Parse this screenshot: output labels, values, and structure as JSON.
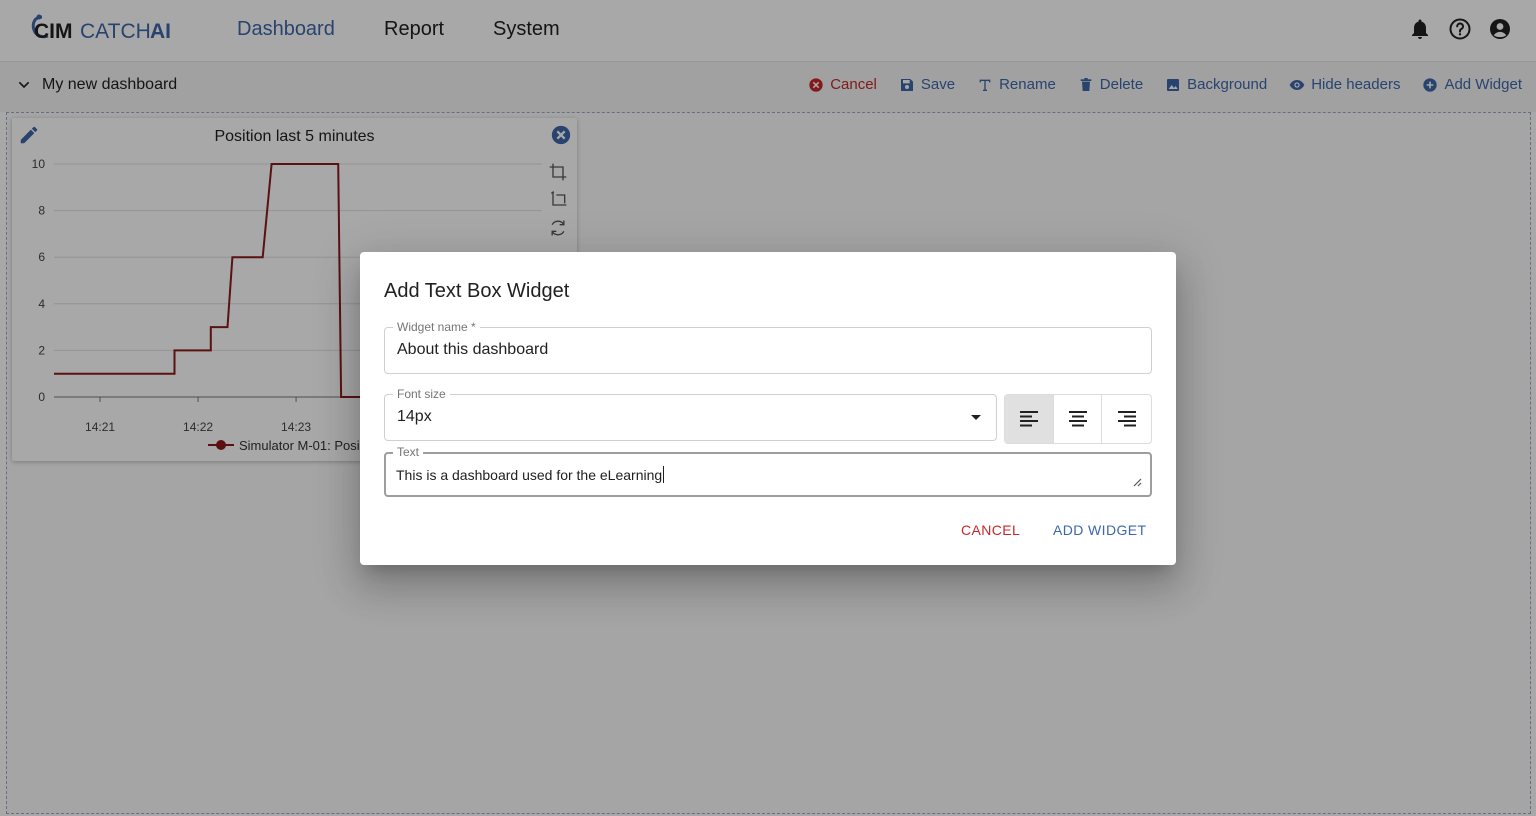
{
  "brand": {
    "cim": "CIM",
    "catch": "CATCH",
    "ai": "AI"
  },
  "nav": {
    "dashboard": "Dashboard",
    "report": "Report",
    "system": "System"
  },
  "header_icons": [
    "bell-icon",
    "help-icon",
    "account-icon"
  ],
  "dashboard": {
    "name": "My new dashboard",
    "toolbar": {
      "cancel": "Cancel",
      "save": "Save",
      "rename": "Rename",
      "delete": "Delete",
      "background": "Background",
      "hide_headers": "Hide headers",
      "add_widget": "Add Widget"
    }
  },
  "widget": {
    "title": "Position last 5 minutes"
  },
  "chart_data": {
    "type": "line",
    "title": "Position last 5 minutes",
    "step": true,
    "yticks": [
      "0",
      "2",
      "4",
      "6",
      "8",
      "10"
    ],
    "xticks": [
      "14:21",
      "14:22",
      "14:23"
    ],
    "ylim": [
      0,
      10
    ],
    "series": [
      {
        "name": "Simulator M-01: Posi",
        "color": "#8b1a1a",
        "points": [
          {
            "x": 0.0,
            "y": 1
          },
          {
            "x": 1.23,
            "y": 1
          },
          {
            "x": 1.23,
            "y": 2
          },
          {
            "x": 1.6,
            "y": 2
          },
          {
            "x": 1.6,
            "y": 3
          },
          {
            "x": 1.77,
            "y": 3
          },
          {
            "x": 1.82,
            "y": 6
          },
          {
            "x": 2.13,
            "y": 6
          },
          {
            "x": 2.22,
            "y": 10
          },
          {
            "x": 2.9,
            "y": 10
          },
          {
            "x": 2.93,
            "y": 0
          },
          {
            "x": 3.2,
            "y": 0
          }
        ]
      }
    ],
    "legend": "bottom"
  },
  "dialog": {
    "title": "Add Text Box Widget",
    "widget_name_label": "Widget name *",
    "widget_name_value": "About this dashboard",
    "font_size_label": "Font size",
    "font_size_value": "14px",
    "text_label": "Text",
    "text_value": "This is a dashboard used for the eLearning",
    "alignment": "left",
    "cancel": "CANCEL",
    "add": "ADD WIDGET"
  }
}
